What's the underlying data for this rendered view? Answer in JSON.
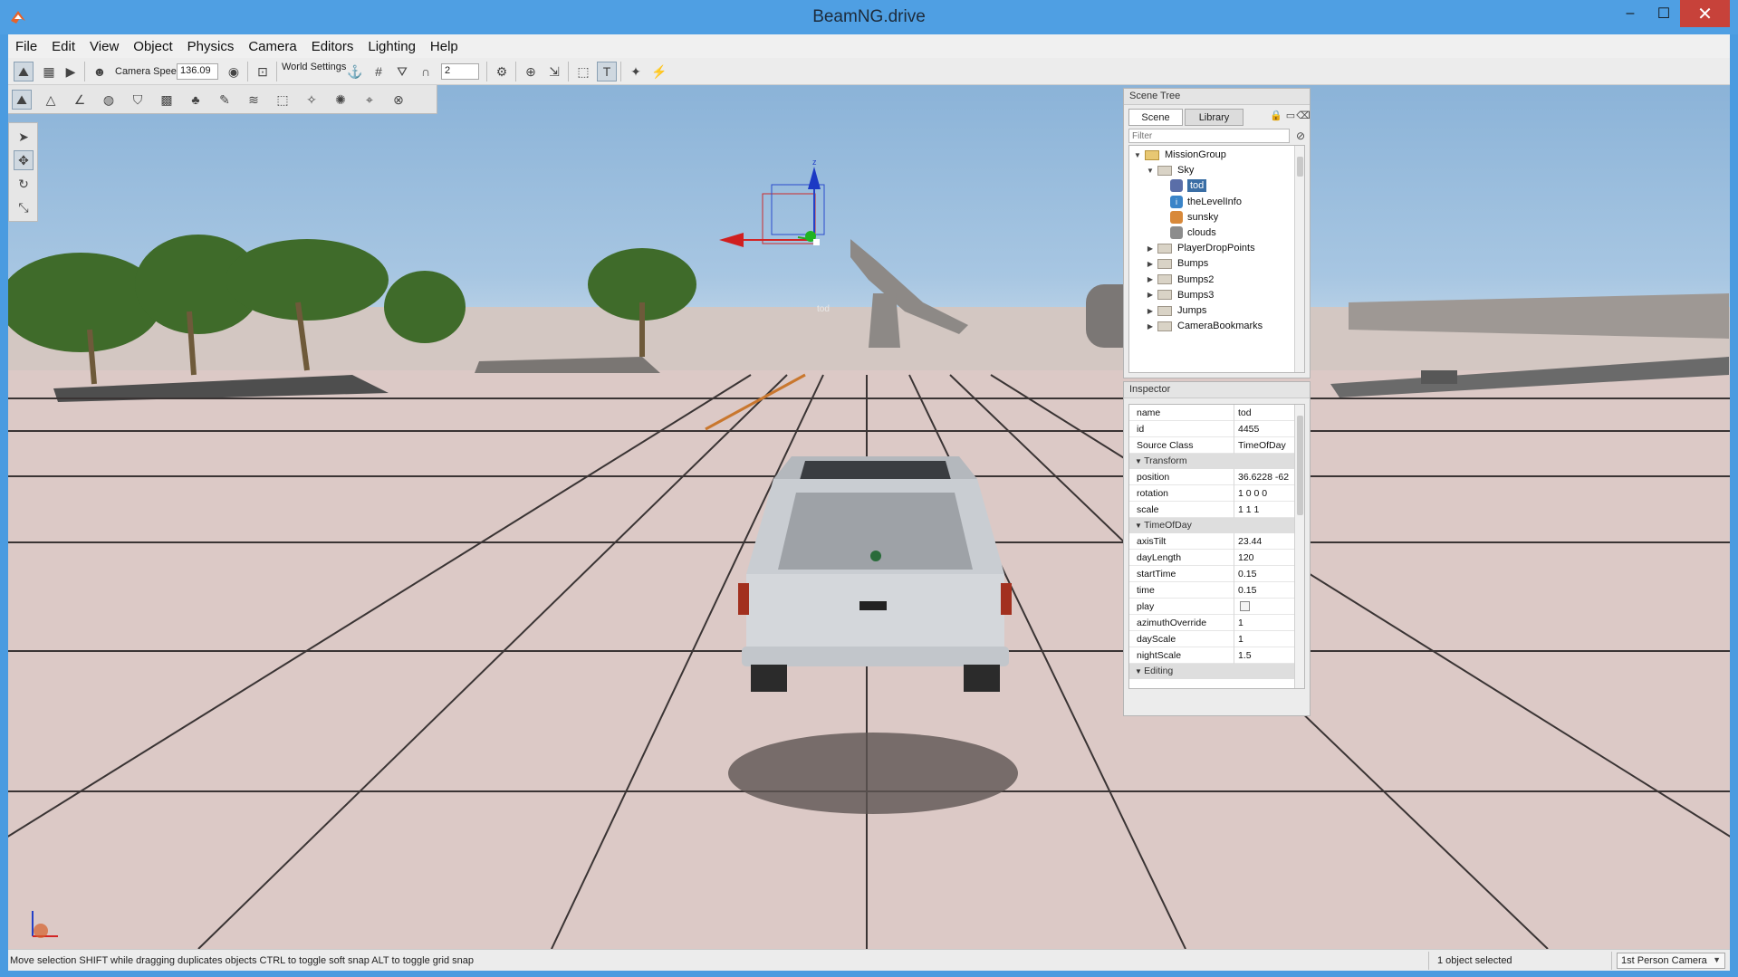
{
  "window": {
    "title": "BeamNG.drive",
    "minimize": "–",
    "maximize": "☐",
    "close": "✕"
  },
  "menu": [
    "File",
    "Edit",
    "View",
    "Object",
    "Physics",
    "Camera",
    "Editors",
    "Lighting",
    "Help"
  ],
  "toolbar": {
    "camera_speed_label": "Camera Speed",
    "camera_speed_value": "136.09",
    "world_settings_label": "World Settings",
    "grid_value": "2"
  },
  "gizmo": {
    "label": "tod",
    "z_axis": "z"
  },
  "scene_tree": {
    "header": "Scene Tree",
    "tabs": [
      "Scene",
      "Library"
    ],
    "filter_placeholder": "Filter",
    "items": [
      {
        "label": "MissionGroup",
        "level": 0,
        "expanded": true,
        "icon": "folder-open-icon"
      },
      {
        "label": "Sky",
        "level": 1,
        "expanded": true,
        "icon": "folder-icon"
      },
      {
        "label": "tod",
        "level": 2,
        "icon": "time-of-day-icon",
        "selected": true
      },
      {
        "label": "theLevelInfo",
        "level": 2,
        "icon": "info-icon"
      },
      {
        "label": "sunsky",
        "level": 2,
        "icon": "sun-icon"
      },
      {
        "label": "clouds",
        "level": 2,
        "icon": "cloud-icon"
      },
      {
        "label": "PlayerDropPoints",
        "level": 1,
        "expanded": false,
        "icon": "folder-icon"
      },
      {
        "label": "Bumps",
        "level": 1,
        "expanded": false,
        "icon": "folder-icon"
      },
      {
        "label": "Bumps2",
        "level": 1,
        "expanded": false,
        "icon": "folder-icon"
      },
      {
        "label": "Bumps3",
        "level": 1,
        "expanded": false,
        "icon": "folder-icon"
      },
      {
        "label": "Jumps",
        "level": 1,
        "expanded": false,
        "icon": "folder-icon"
      },
      {
        "label": "CameraBookmarks",
        "level": 1,
        "expanded": false,
        "icon": "folder-icon"
      }
    ]
  },
  "inspector": {
    "header": "Inspector",
    "fields": [
      {
        "key": "name",
        "value": "tod"
      },
      {
        "key": "id",
        "value": "4455"
      },
      {
        "key": "Source Class",
        "value": "TimeOfDay"
      }
    ],
    "groups": [
      {
        "title": "Transform",
        "fields": [
          {
            "key": "position",
            "value": "36.6228 -62"
          },
          {
            "key": "rotation",
            "value": "1 0 0 0"
          },
          {
            "key": "scale",
            "value": "1 1 1"
          }
        ]
      },
      {
        "title": "TimeOfDay",
        "fields": [
          {
            "key": "axisTilt",
            "value": "23.44"
          },
          {
            "key": "dayLength",
            "value": "120"
          },
          {
            "key": "startTime",
            "value": "0.15"
          },
          {
            "key": "time",
            "value": "0.15"
          },
          {
            "key": "play",
            "value": ""
          },
          {
            "key": "azimuthOverride",
            "value": "1"
          },
          {
            "key": "dayScale",
            "value": "1"
          },
          {
            "key": "nightScale",
            "value": "1.5"
          }
        ]
      },
      {
        "title": "Editing",
        "fields": []
      }
    ]
  },
  "status": {
    "message": "Move selection   SHIFT while dragging duplicates objects   CTRL to toggle soft snap   ALT to toggle grid snap",
    "selection": "1 object selected",
    "camera_mode": "1st Person Camera"
  },
  "colors": {
    "titlebar": "#4f9fe3",
    "close": "#c7423a",
    "sky": "#a7c6e2",
    "ground": "#dcc9c6"
  }
}
